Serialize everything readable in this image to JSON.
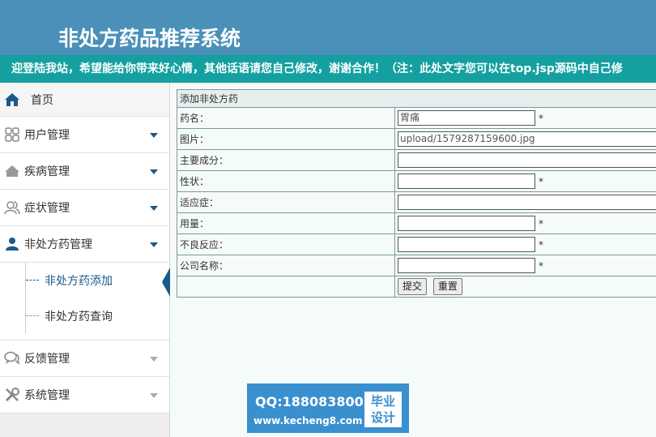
{
  "header": {
    "title": "非处方药品推荐系统"
  },
  "marquee": {
    "text": "迎登陆我站，希望能给你带来好心情，其他话语请您自己修改，谢谢合作！（注：此处文字您可以在top.jsp源码中自己修"
  },
  "sidebar": {
    "home": {
      "label": "首页",
      "icon": "home-icon"
    },
    "items": [
      {
        "label": "用户管理",
        "icon": "grid-icon"
      },
      {
        "label": "疾病管理",
        "icon": "house-icon"
      },
      {
        "label": "症状管理",
        "icon": "users-icon"
      },
      {
        "label": "非处方药管理",
        "icon": "user-icon"
      }
    ],
    "submenu": [
      {
        "label": "非处方药添加"
      },
      {
        "label": "非处方药查询"
      }
    ],
    "items_after": [
      {
        "label": "反馈管理",
        "icon": "chat-icon"
      },
      {
        "label": "系统管理",
        "icon": "tools-icon"
      }
    ]
  },
  "form": {
    "title": "添加非处方药",
    "rows": [
      {
        "label": "药名：",
        "value": "胃痛",
        "required": "*"
      },
      {
        "label": "图片：",
        "value": "upload/1579287159600.jpg",
        "required": ""
      },
      {
        "label": "主要成分：",
        "value": "",
        "required": ""
      },
      {
        "label": "性状：",
        "value": "",
        "required": "*"
      },
      {
        "label": "适应症：",
        "value": "",
        "required": ""
      },
      {
        "label": "用量：",
        "value": "",
        "required": "*"
      },
      {
        "label": "不良反应：",
        "value": "",
        "required": "*"
      },
      {
        "label": "公司名称：",
        "value": "",
        "required": "*"
      }
    ],
    "submit_label": "提交",
    "reset_label": "重置"
  },
  "watermark": {
    "qq": "QQ:188083800",
    "site": "www.kecheng8.com",
    "badge_line1": "毕业",
    "badge_line2": "设计"
  }
}
